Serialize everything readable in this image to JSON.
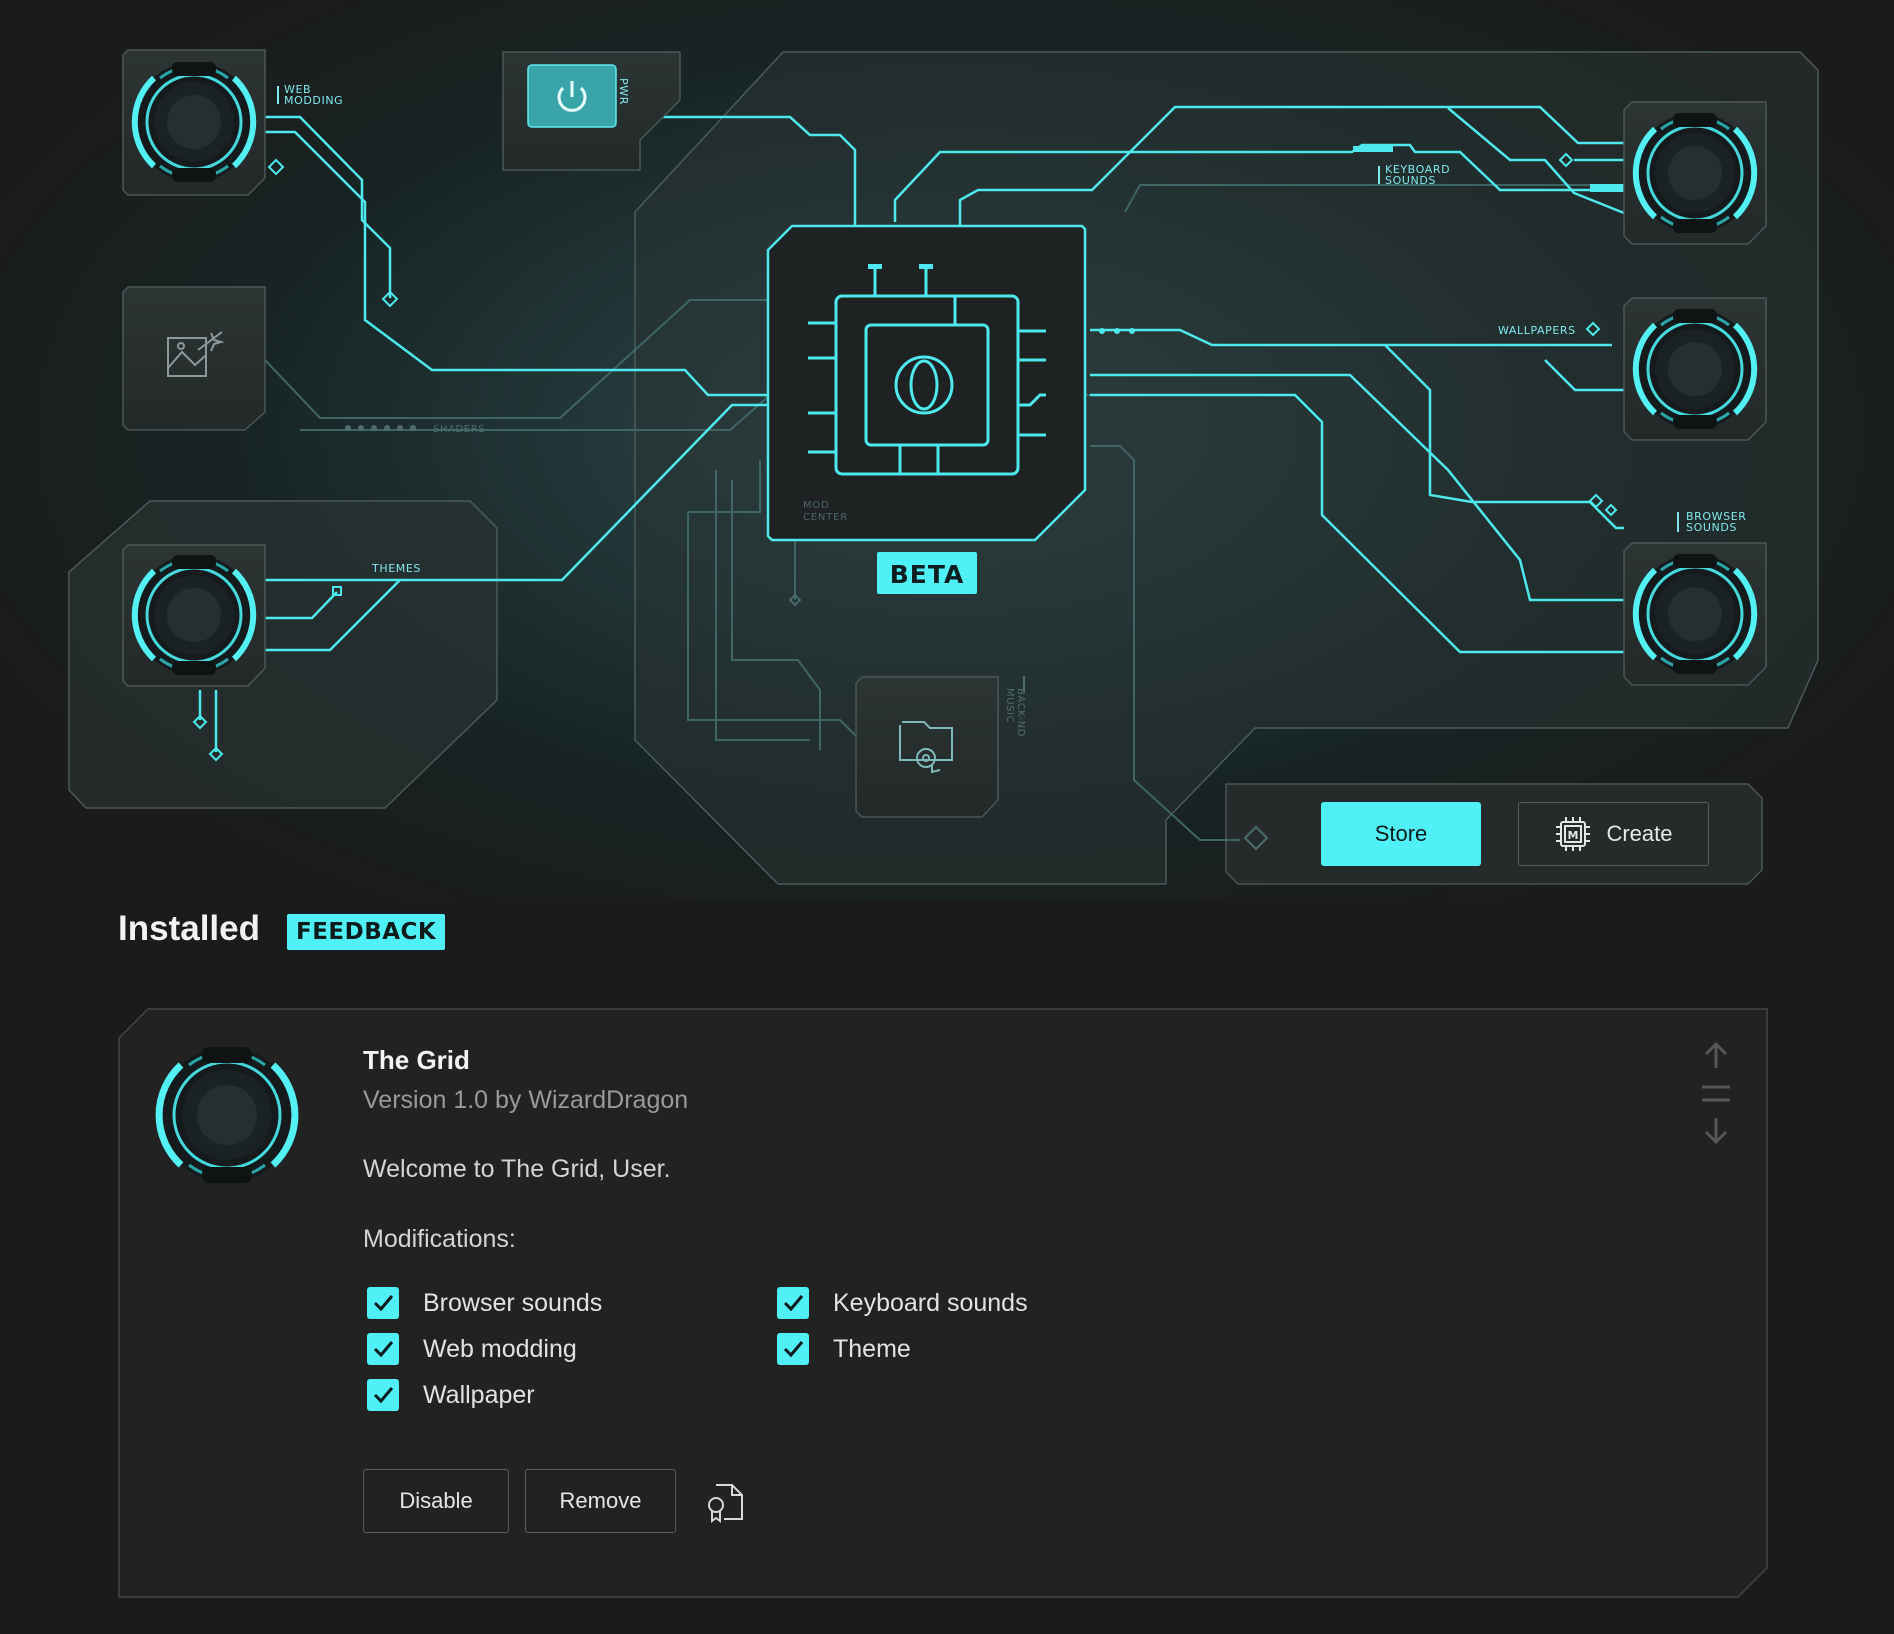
{
  "hero": {
    "nodes": {
      "web_modding": "WEB\nMODDING",
      "pwr": "PWR",
      "keyboard_sounds": "KEYBOARD\nSOUNDS",
      "wallpapers": "WALLPAPERS",
      "browser_sounds": "BROWSER\nSOUNDS",
      "shaders": "SHADERS",
      "themes": "THEMES",
      "backend_music": "BACK-ND\nMUSIC",
      "mod_center": "MOD\nCENTER"
    },
    "beta_badge": "BETA",
    "store_label": "Store",
    "create_label": "Create",
    "create_chip_letter": "M"
  },
  "installed": {
    "title": "Installed",
    "feedback_label": "FEEDBACK"
  },
  "mod": {
    "name": "The Grid",
    "version": "Version 1.0 by WizardDragon",
    "description": "Welcome to The Grid, User.",
    "modifications_heading": "Modifications:",
    "modifications": [
      {
        "label": "Browser sounds",
        "checked": true
      },
      {
        "label": "Web modding",
        "checked": true
      },
      {
        "label": "Wallpaper",
        "checked": true
      },
      {
        "label": "Keyboard sounds",
        "checked": true
      },
      {
        "label": "Theme",
        "checked": true
      }
    ],
    "disable_label": "Disable",
    "remove_label": "Remove"
  },
  "colors": {
    "accent": "#4ff1f6",
    "background": "#1b1b1b",
    "panel": "#222222",
    "muted_text": "#9a9a9a"
  }
}
